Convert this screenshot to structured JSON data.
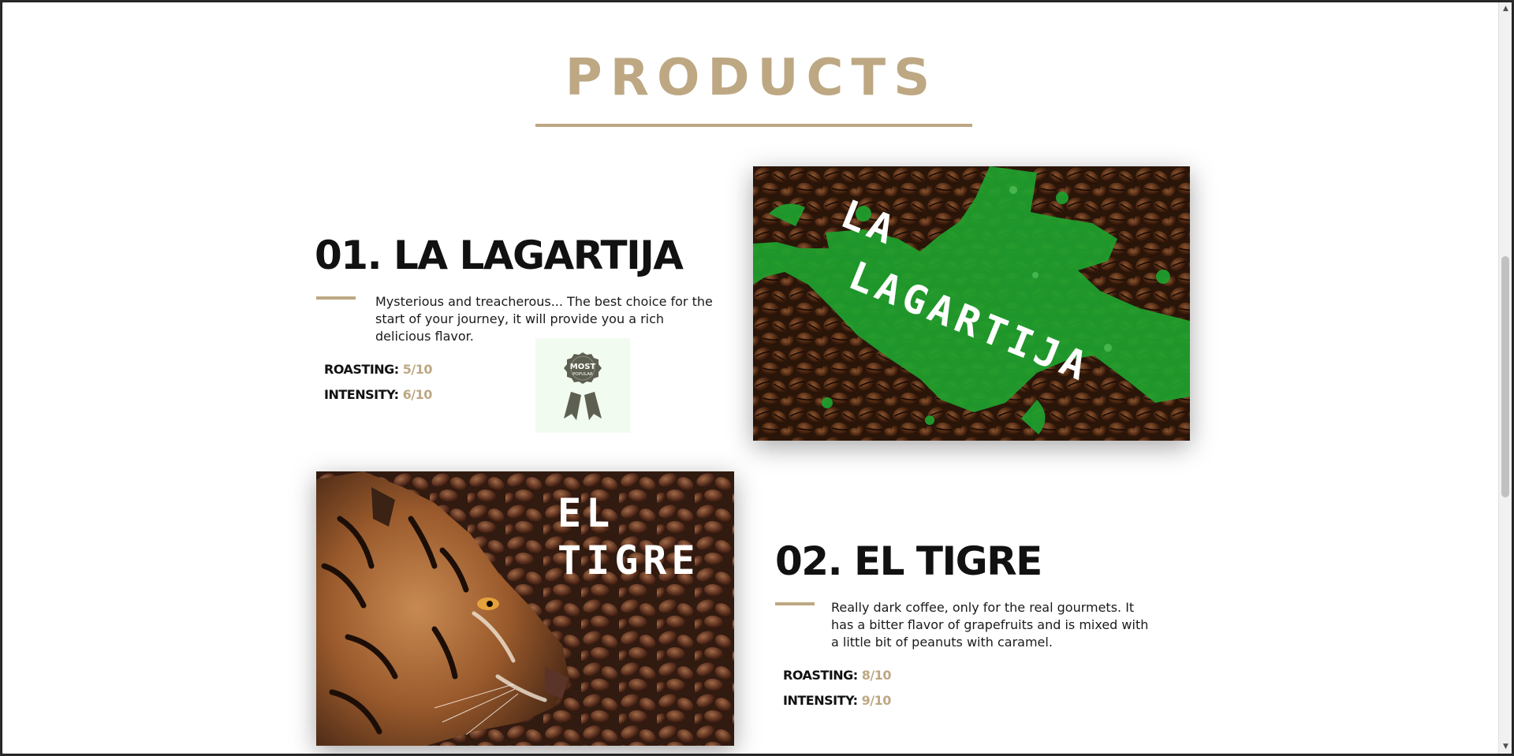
{
  "section": {
    "title": "PRODUCTS"
  },
  "products": [
    {
      "name": "01. LA LAGARTIJA",
      "description": "Mysterious and treacherous... The best choice for the start of your journey, it will provide you a rich delicious flavor.",
      "roasting_label": "ROASTING:",
      "roasting_value": "5/10",
      "intensity_label": "INTENSITY:",
      "intensity_value": "6/10",
      "image_text": [
        "LA",
        "LAGARTIJA"
      ],
      "badge": {
        "line1": "MOST",
        "line2": "POPULAR"
      }
    },
    {
      "name": "02. EL TIGRE",
      "description": "Really dark coffee, only for the real gourmets. It has a bitter flavor of grapefruits and is mixed with a little bit of peanuts with caramel.",
      "roasting_label": "ROASTING:",
      "roasting_value": "8/10",
      "intensity_label": "INTENSITY:",
      "intensity_value": "9/10",
      "image_text": [
        "EL",
        "TIGRE"
      ]
    }
  ],
  "colors": {
    "accent": "#bda883",
    "lizard_green": "#1fa22e",
    "coffee_dark": "#2a1509"
  },
  "icons": {
    "badge": "ribbon-award-icon",
    "scroll_up": "arrow-up-icon",
    "scroll_down": "arrow-down-icon"
  }
}
